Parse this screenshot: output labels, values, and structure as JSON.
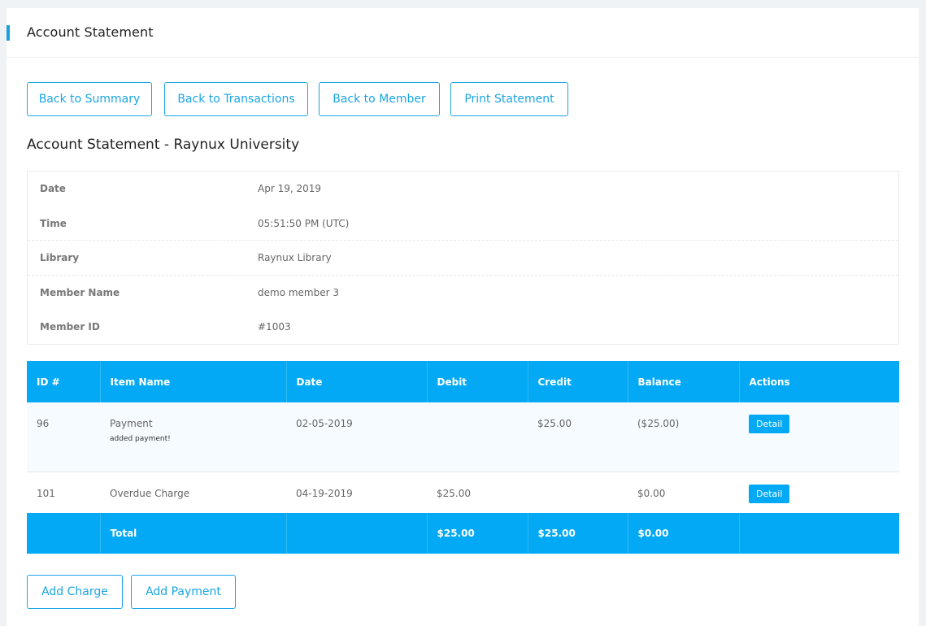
{
  "header": {
    "title": "Account Statement"
  },
  "toolbar": {
    "back_summary": "Back to Summary",
    "back_transactions": "Back to Transactions",
    "back_member": "Back to Member",
    "print_statement": "Print Statement"
  },
  "statement": {
    "title": "Account Statement - Raynux University",
    "info": [
      {
        "label": "Date",
        "value": "Apr 19, 2019"
      },
      {
        "label": "Time",
        "value": "05:51:50 PM (UTC)"
      },
      {
        "label": "Library",
        "value": "Raynux Library"
      },
      {
        "label": "Member Name",
        "value": "demo member 3"
      },
      {
        "label": "Member ID",
        "value": "#1003"
      }
    ]
  },
  "table": {
    "columns": [
      "ID #",
      "Item Name",
      "Date",
      "Debit",
      "Credit",
      "Balance",
      "Actions"
    ],
    "rows": [
      {
        "id": "96",
        "item": "Payment",
        "note": "added payment!",
        "date": "02-05-2019",
        "debit": "",
        "credit": "$25.00",
        "balance": "($25.00)",
        "action": "Detail"
      },
      {
        "id": "101",
        "item": "Overdue Charge",
        "note": "",
        "date": "04-19-2019",
        "debit": "$25.00",
        "credit": "",
        "balance": "$0.00",
        "action": "Detail"
      }
    ],
    "total": {
      "label": "Total",
      "debit": "$25.00",
      "credit": "$25.00",
      "balance": "$0.00"
    }
  },
  "actions": {
    "add_charge": "Add Charge",
    "add_payment": "Add Payment"
  },
  "colors": {
    "accent": "#03a9f4",
    "button_border": "#19a5e4"
  }
}
